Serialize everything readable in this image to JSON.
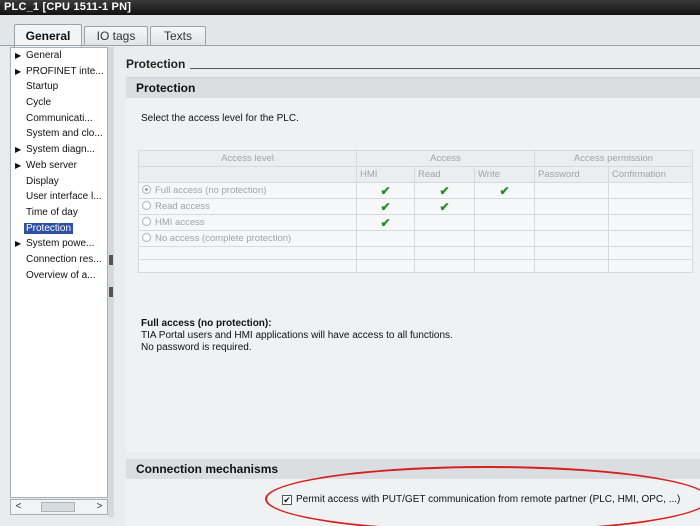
{
  "window": {
    "title": "PLC_1 [CPU 1511-1 PN]"
  },
  "tabs": [
    {
      "label": "General",
      "active": true
    },
    {
      "label": "IO tags",
      "active": false
    },
    {
      "label": "Texts",
      "active": false
    }
  ],
  "sidebar": {
    "items": [
      {
        "label": "General",
        "expandable": true,
        "selected": false
      },
      {
        "label": "PROFINET inte...",
        "expandable": true,
        "selected": false
      },
      {
        "label": "Startup",
        "expandable": false,
        "selected": false
      },
      {
        "label": "Cycle",
        "expandable": false,
        "selected": false
      },
      {
        "label": "Communicati...",
        "expandable": false,
        "selected": false
      },
      {
        "label": "System and clo...",
        "expandable": false,
        "selected": false
      },
      {
        "label": "System diagn...",
        "expandable": true,
        "selected": false
      },
      {
        "label": "Web server",
        "expandable": true,
        "selected": false
      },
      {
        "label": "Display",
        "expandable": false,
        "selected": false
      },
      {
        "label": "User interface l...",
        "expandable": false,
        "selected": false
      },
      {
        "label": "Time of day",
        "expandable": false,
        "selected": false
      },
      {
        "label": "Protection",
        "expandable": false,
        "selected": true
      },
      {
        "label": "System powe...",
        "expandable": true,
        "selected": false
      },
      {
        "label": "Connection res...",
        "expandable": false,
        "selected": false
      },
      {
        "label": "Overview of a...",
        "expandable": false,
        "selected": false
      }
    ],
    "scroll_left": "<",
    "scroll_right": ">"
  },
  "section": {
    "title": "Protection"
  },
  "protection": {
    "heading": "Protection",
    "intro": "Select the access level for the PLC.",
    "table": {
      "group_headers": [
        "Access level",
        "Access",
        "Access permission"
      ],
      "sub_headers": [
        "HMI",
        "Read",
        "Write",
        "Password",
        "Confirmation"
      ],
      "rows": [
        {
          "label": "Full access (no protection)",
          "selected": true,
          "hmi": true,
          "read": true,
          "write": true
        },
        {
          "label": "Read access",
          "selected": false,
          "hmi": true,
          "read": true,
          "write": false
        },
        {
          "label": "HMI access",
          "selected": false,
          "hmi": true,
          "read": false,
          "write": false
        },
        {
          "label": "No access (complete protection)",
          "selected": false,
          "hmi": false,
          "read": false,
          "write": false
        }
      ]
    },
    "description": {
      "heading": "Full access (no protection):",
      "line1": "TIA Portal users and HMI applications will have access to all functions.",
      "line2": "No password is required."
    }
  },
  "connection": {
    "heading": "Connection mechanisms",
    "permit_label": "Permit access with PUT/GET communication from remote partner (PLC, HMI, OPC, ...)",
    "permit_checked": true
  },
  "colors": {
    "selection": "#2e4fa3",
    "check": "#2a8c2a",
    "annotation": "#d61f1f"
  }
}
